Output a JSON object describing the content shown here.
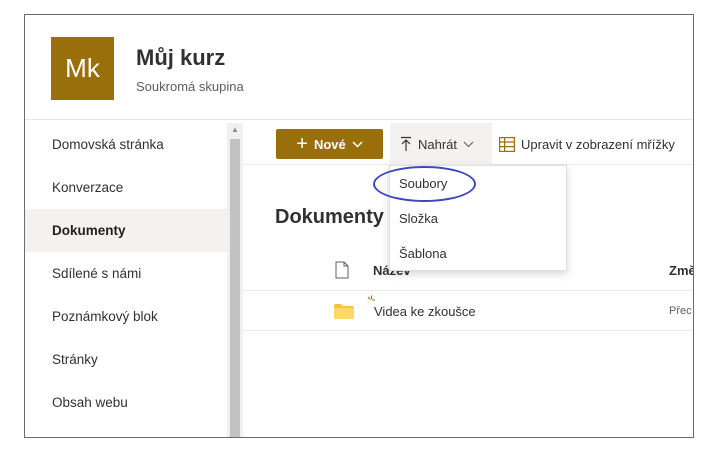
{
  "site": {
    "logo_initials": "Mk",
    "title": "Můj kurz",
    "subtitle": "Soukromá skupina",
    "accent_color": "#986f0b"
  },
  "sidebar": {
    "items": [
      {
        "label": "Domovská stránka"
      },
      {
        "label": "Konverzace"
      },
      {
        "label": "Dokumenty"
      },
      {
        "label": "Sdílené s námi"
      },
      {
        "label": "Poznámkový blok"
      },
      {
        "label": "Stránky"
      },
      {
        "label": "Obsah webu"
      }
    ],
    "active_item": "Dokumenty"
  },
  "toolbar": {
    "new_label": "Nové",
    "upload_label": "Nahrát",
    "grid_label": "Upravit v zobrazení mřížky"
  },
  "upload_menu": {
    "items": [
      {
        "label": "Soubory"
      },
      {
        "label": "Složka"
      },
      {
        "label": "Šablona"
      }
    ],
    "highlighted": "Soubory",
    "highlight_color": "#3d49b8"
  },
  "library": {
    "heading": "Dokumenty",
    "columns": {
      "name": "Název",
      "modified": "Změ"
    },
    "rows": [
      {
        "name": "Videa ke zkoušce",
        "modified": "Přec"
      }
    ]
  },
  "icons": [
    "plus-icon",
    "chevron-down-icon",
    "upload-arrow-icon",
    "grid-icon",
    "file-icon",
    "folder-icon",
    "new-item-icon"
  ]
}
